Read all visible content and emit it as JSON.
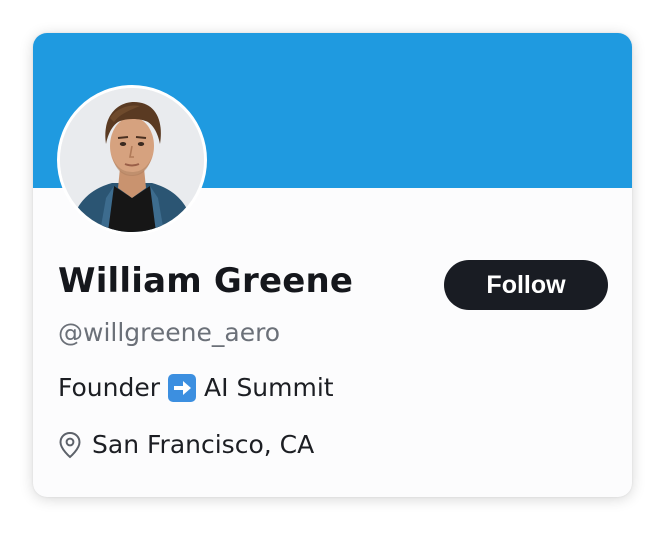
{
  "colors": {
    "banner": "#1f9ae0",
    "follow_button_bg": "#191c23",
    "follow_button_text": "#ffffff",
    "name_text": "#15171c",
    "handle_text": "#6b7078",
    "card_bg": "#fcfcfd"
  },
  "profile": {
    "name": "William Greene",
    "handle": "@willgreene_aero",
    "avatar_icon": "profile-photo",
    "follow_label": "Follow",
    "bio": {
      "prefix": "Founder",
      "emoji_icon": "right-arrow-emoji-icon",
      "suffix": "AI Summit"
    },
    "location": {
      "icon": "location-pin-icon",
      "text": "San Francisco, CA"
    }
  }
}
